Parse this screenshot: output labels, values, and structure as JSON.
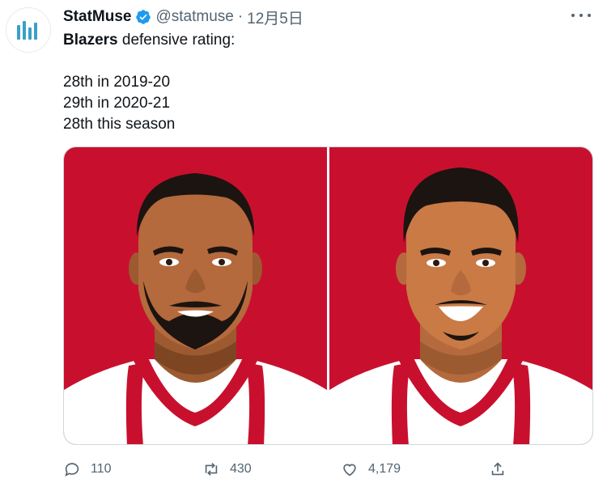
{
  "tweet": {
    "author_name": "StatMuse",
    "author_handle": "@statmuse",
    "separator": "·",
    "timestamp": "12月5日",
    "text_bold": "Blazers",
    "text_line1_rest": " defensive rating:",
    "lines": [
      "28th in 2019-20",
      "29th in 2020-21",
      "28th this season"
    ]
  },
  "media": {
    "image_left": "player-illustration-left",
    "image_right": "player-illustration-right",
    "background_color": "#c8102e"
  },
  "actions": {
    "reply_count": "110",
    "retweet_count": "430",
    "like_count": "4,179"
  },
  "colors": {
    "verified": "#1d9bf0",
    "secondary_text": "#536471",
    "logo": "#3aa0c8"
  }
}
